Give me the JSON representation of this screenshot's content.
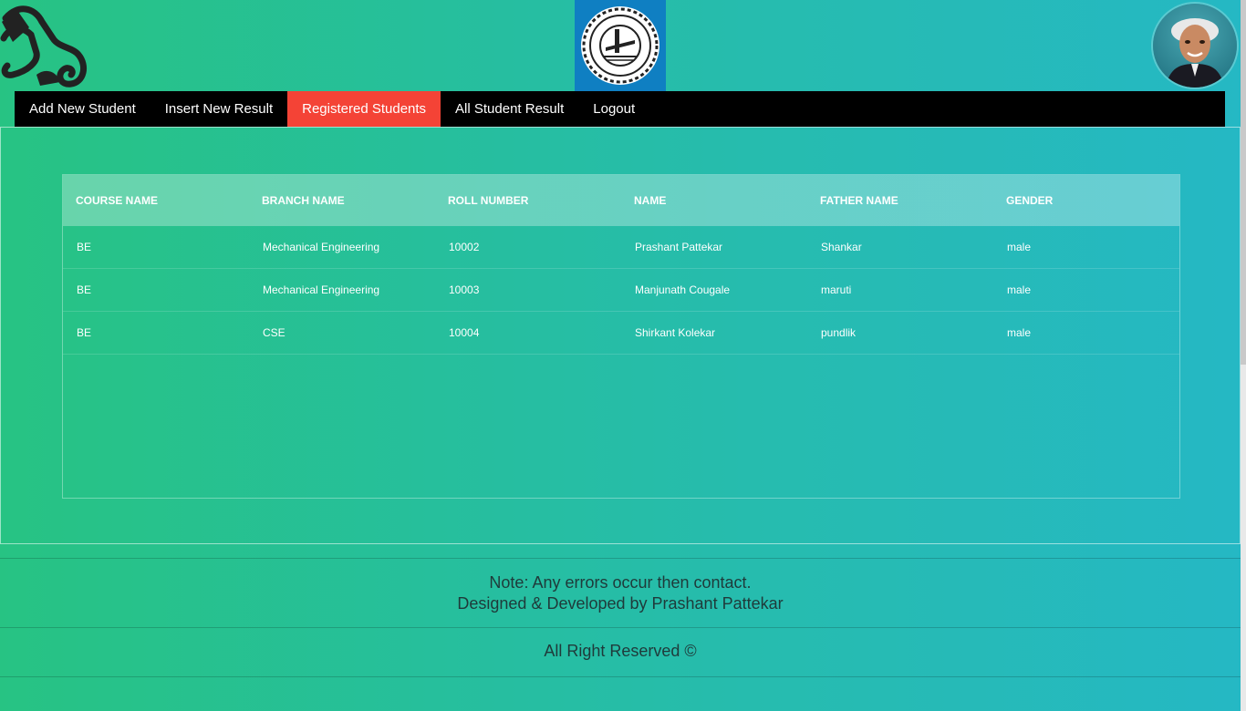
{
  "nav": {
    "items": [
      {
        "label": "Add New Student",
        "active": false
      },
      {
        "label": "Insert New Result",
        "active": false
      },
      {
        "label": "Registered Students",
        "active": true
      },
      {
        "label": "All Student Result",
        "active": false
      },
      {
        "label": "Logout",
        "active": false
      }
    ],
    "active_color": "#f44336"
  },
  "header": {
    "left_logo": "scroll-logo-icon",
    "center_logo": "college-seal-icon",
    "avatar": "avatar-photo"
  },
  "table": {
    "columns": [
      "COURSE NAME",
      "BRANCH NAME",
      "ROLL NUMBER",
      "NAME",
      "FATHER NAME",
      "GENDER"
    ],
    "rows": [
      [
        "BE",
        "Mechanical Engineering",
        "10002",
        "Prashant Pattekar",
        "Shankar",
        "male"
      ],
      [
        "BE",
        "Mechanical Engineering",
        "10003",
        "Manjunath Cougale",
        "maruti",
        "male"
      ],
      [
        "BE",
        "CSE",
        "10004",
        "Shirkant Kolekar",
        "pundlik",
        "male"
      ]
    ]
  },
  "footer": {
    "note_line1": "Note: Any errors occur then contact.",
    "note_line2": "Designed & Developed by Prashant Pattekar",
    "copyright": "All Right Reserved ©"
  },
  "colors": {
    "gradient_start": "#27c383",
    "gradient_end": "#25b8c4",
    "navbar_bg": "#000000"
  }
}
